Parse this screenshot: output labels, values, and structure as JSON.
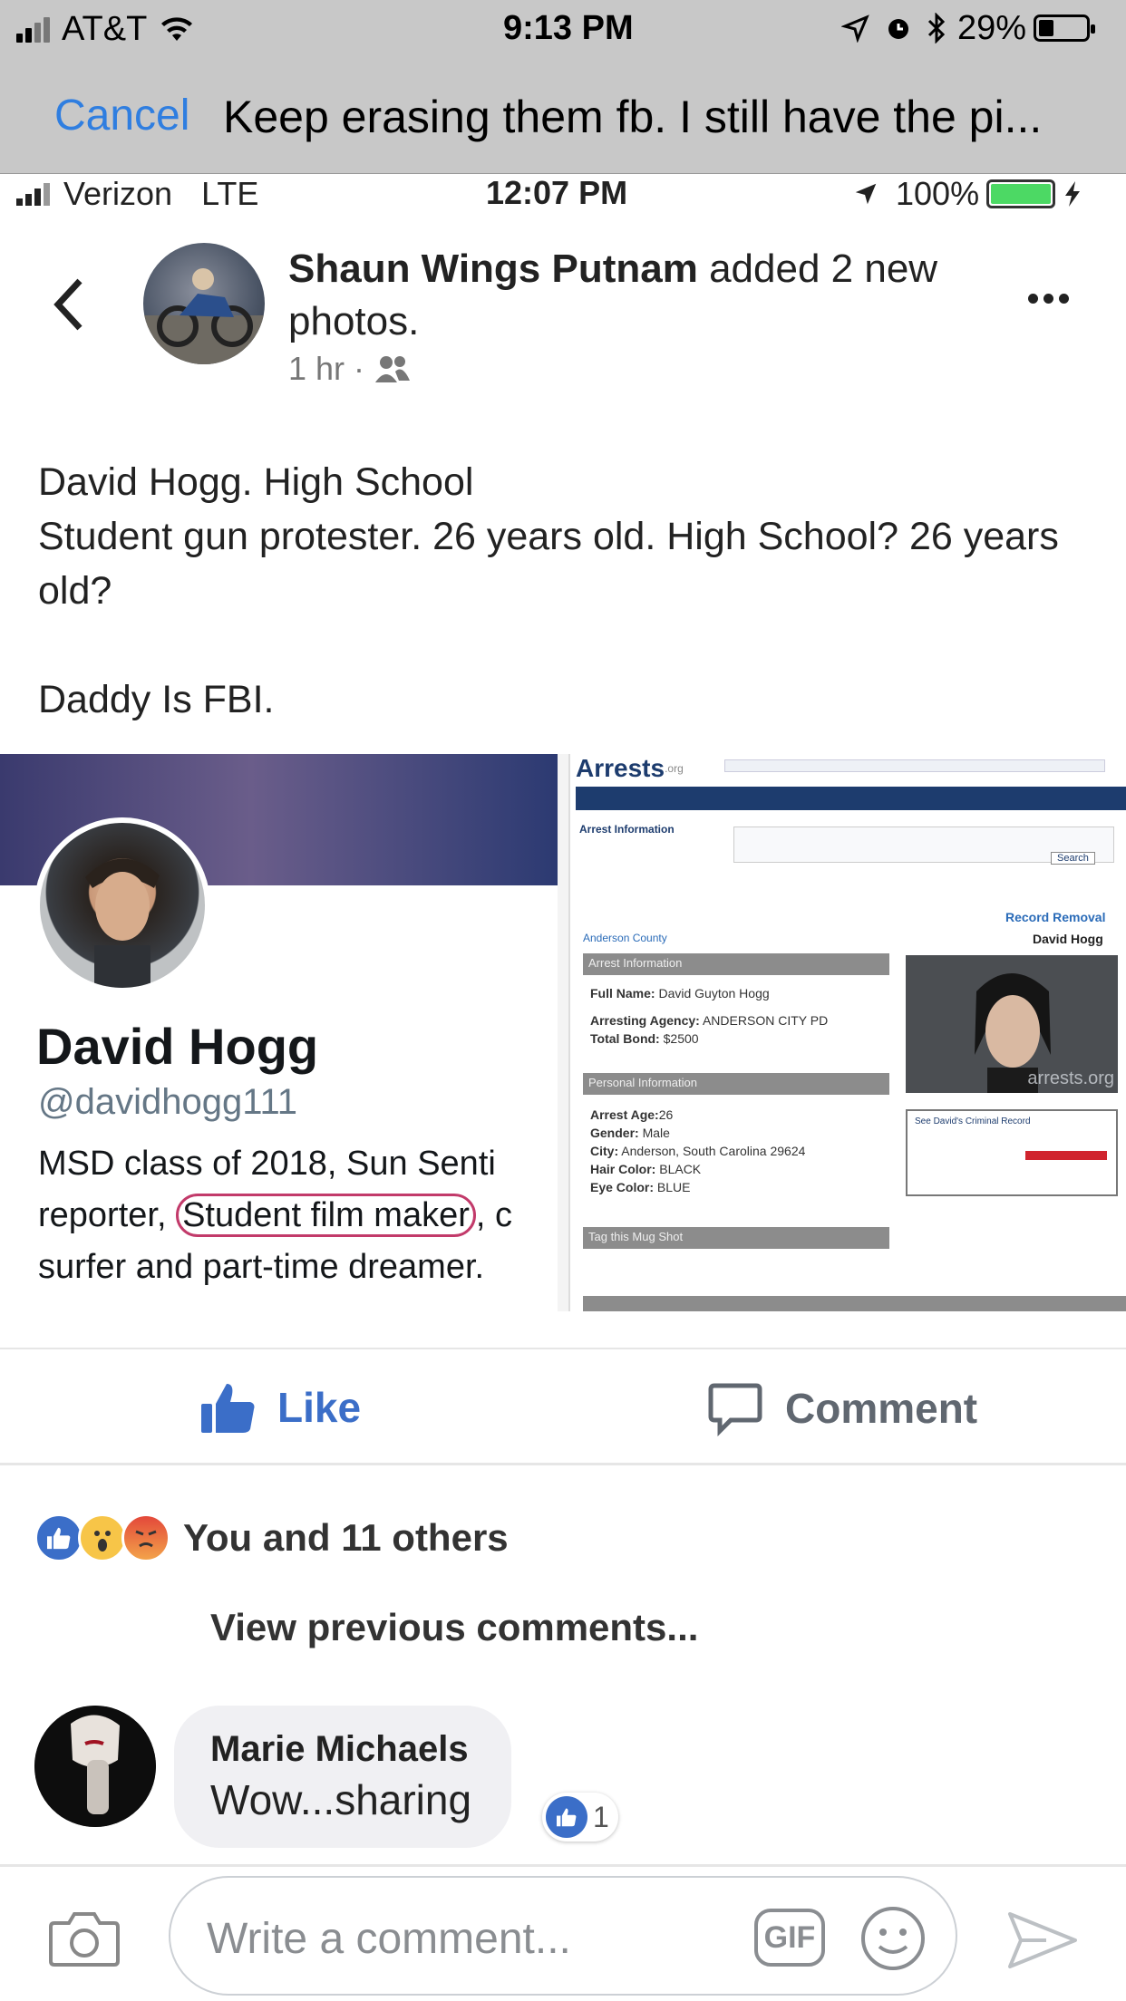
{
  "outer_status": {
    "carrier": "AT&T",
    "time": "9:13 PM",
    "battery": "29%"
  },
  "outer_header": {
    "cancel_label": "Cancel",
    "title": "Keep erasing them fb. I still have the pi..."
  },
  "inner_status": {
    "carrier": "Verizon",
    "network": "LTE",
    "time": "12:07 PM",
    "battery": "100%"
  },
  "post": {
    "author": "Shaun Wings Putnam",
    "action": " added 2 new photos.",
    "time": "1 hr ·",
    "text_lines": [
      "David Hogg. High School",
      "Student gun protester. 26 years old. High School? 26 years old?",
      "",
      "Daddy Is FBI."
    ]
  },
  "photo_left": {
    "name": "David Hogg",
    "handle": "@davidhogg111",
    "bio_line1": "MSD class of 2018, Sun Senti",
    "bio_line2_pre": "reporter, ",
    "bio_line2_circled": "Student film maker",
    "bio_line2_post": ", c",
    "bio_line3": "surfer and part-time dreamer."
  },
  "photo_right": {
    "site": "Arrests",
    "site_suffix": ".org",
    "arrest_info": "Arrest Information",
    "record_removal": "Record Removal",
    "county": "Anderson County",
    "name": "David Hogg",
    "section_arrest": "Arrest Information",
    "full_name_label": "Full Name:",
    "full_name": "David Guyton Hogg",
    "agency_label": "Arresting Agency:",
    "agency": "ANDERSON CITY PD",
    "bond_label": "Total Bond:",
    "bond": "$2500",
    "section_personal": "Personal Information",
    "age_label": "Arrest Age:",
    "age": "26",
    "gender_label": "Gender:",
    "gender": "Male",
    "city_label": "City:",
    "city": "Anderson, South Carolina 29624",
    "hair_label": "Hair Color:",
    "hair": "BLACK",
    "eye_label": "Eye Color:",
    "eye": "BLUE",
    "section_tag": "Tag this Mug Shot",
    "watermark": "arrests.org",
    "criminal_record": "See David's Criminal Record",
    "search_label": "Search"
  },
  "actions": {
    "like": "Like",
    "comment": "Comment"
  },
  "reactions_text": "You and 11 others",
  "view_previous": "View previous comments...",
  "comment": {
    "author": "Marie Michaels",
    "text": "Wow...sharing",
    "likes": "1"
  },
  "composer": {
    "placeholder": "Write a comment...",
    "gif": "GIF"
  },
  "colors": {
    "ios_blue": "#2f7ee0",
    "fb_blue": "#4267b2",
    "like_blue": "#3b6ec8",
    "header_gray": "#c8c8c8"
  }
}
